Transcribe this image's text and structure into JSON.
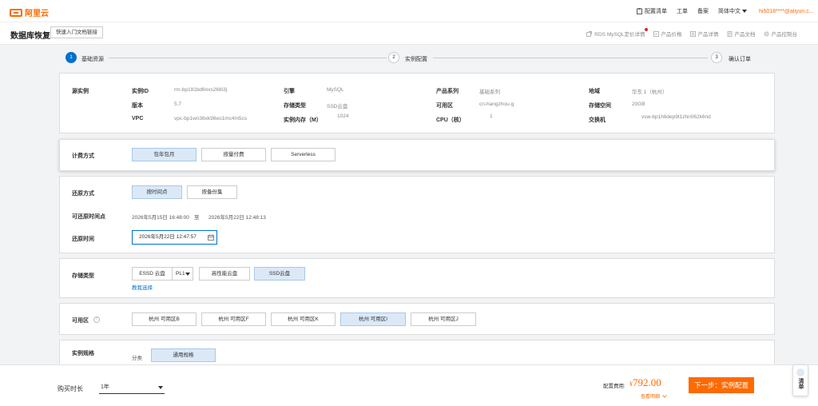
{
  "brand": {
    "name": "阿里云"
  },
  "topnav": {
    "items": [
      "配置清单",
      "工单",
      "备案",
      "简体中文"
    ],
    "account": "hi5018****@aliyun.c..."
  },
  "title": {
    "page": "数据库恢复",
    "quick_button": "快速入门文档链接",
    "links": [
      "RDS MySQL定价详情",
      "产品价格",
      "产品详情",
      "产品文档",
      "产品控制台"
    ]
  },
  "steps": [
    {
      "num": "1",
      "label": "基础资源"
    },
    {
      "num": "2",
      "label": "实例配置"
    },
    {
      "num": "3",
      "label": "确认订单"
    }
  ],
  "source": {
    "section_label": "源实例",
    "fields": [
      {
        "key": "实例ID",
        "value": "rm-bp181bd6nxs268i3j"
      },
      {
        "key": "引擎",
        "value": "MySQL"
      },
      {
        "key": "产品系列",
        "value": "基础系列"
      },
      {
        "key": "地域",
        "value": "华东 1（杭州）"
      },
      {
        "key": "版本",
        "value": "5.7"
      },
      {
        "key": "存储类型",
        "value": "SSD云盘"
      },
      {
        "key": "可用区",
        "value": "cn-hangzhou-g"
      },
      {
        "key": "存储空间",
        "value": "20GB"
      },
      {
        "key": "VPC",
        "value": "vpc-bp1wn36xk98eo1mc4m5cs"
      },
      {
        "key": "实例内存（M）",
        "value": "1024"
      },
      {
        "key": "CPU（核）",
        "value": "1"
      },
      {
        "key": "交换机",
        "value": "vsw-bp1h6dep9t1zhn062k6nd"
      }
    ]
  },
  "billing": {
    "label": "计费方式",
    "options": [
      "包年包月",
      "按量付费",
      "Serverless"
    ],
    "selected": "包年包月"
  },
  "restore": {
    "method_label": "还原方式",
    "options": [
      "按时间点",
      "按备份集"
    ],
    "selected": "按时间点",
    "range_label": "可还原时间点",
    "range_start": "2026年5月15日 16:48:00",
    "range_sep": "至",
    "range_end": "2026年5月22日 12:48:13",
    "time_label": "还原时间",
    "time_value": "2026年5月22日 12:47:57"
  },
  "storage": {
    "label": "存储类型",
    "essd_label": "ESSD 云盘",
    "pl_value": "PL1",
    "options": [
      "高性能云盘",
      "SSD云盘"
    ],
    "selected": "SSD云盘",
    "help_link": "教我选择"
  },
  "zone": {
    "label": "可用区",
    "options": [
      "杭州 可用区B",
      "杭州 可用区F",
      "杭州 可用区K",
      "杭州 可用区I",
      "杭州 可用区J"
    ],
    "selected": "杭州 可用区I"
  },
  "spec": {
    "label": "实例规格",
    "sub_label": "分类",
    "options": [
      "通用规格"
    ]
  },
  "footer": {
    "duration_label": "购买时长",
    "duration_value": "1年",
    "fee_label": "配置费用:",
    "fee_currency": "¥",
    "fee_amount": "792.00",
    "detail_link": "查看明细",
    "next_button": "下一步：实例配置",
    "float_label": "清单"
  },
  "colors": {
    "accent": "#ff6a00",
    "primary": "#0070cc",
    "selected_bg": "#dbe9f7"
  }
}
